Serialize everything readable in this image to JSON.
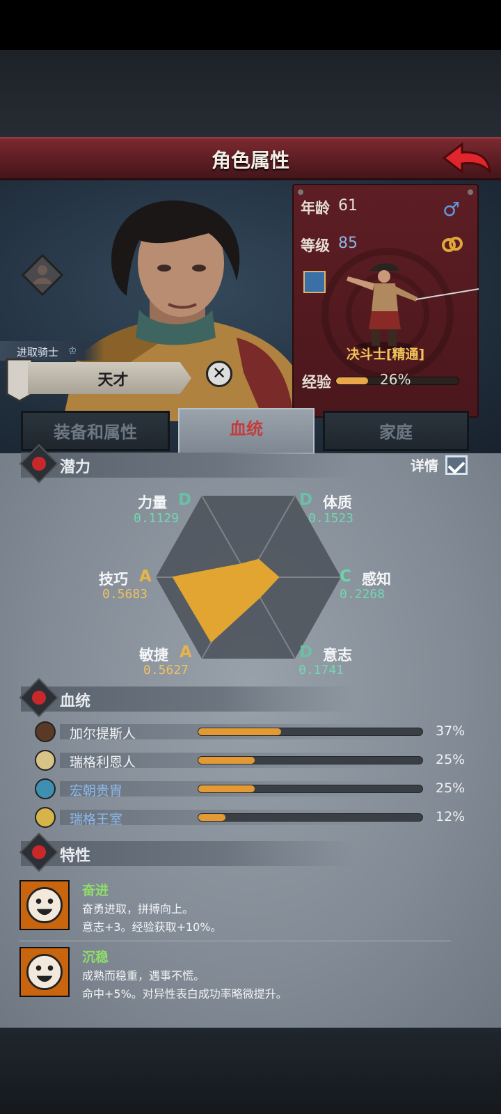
{
  "header": {
    "title": "角色属性"
  },
  "character": {
    "rank_label": "进取骑士",
    "talent": "天才",
    "age_label": "年龄",
    "age": "61",
    "level_label": "等级",
    "level": "85",
    "class_name": "决斗士[精通]",
    "exp_label": "经验",
    "exp_percent": "26%",
    "exp_fraction": 0.26
  },
  "tabs": [
    {
      "label": "装备和属性",
      "active": false
    },
    {
      "label": "血统",
      "active": true
    },
    {
      "label": "家庭",
      "active": false
    }
  ],
  "potential": {
    "title": "潜力",
    "detail_label": "详情",
    "attributes": [
      {
        "name": "力量",
        "grade": "D",
        "value": "0.1129"
      },
      {
        "name": "体质",
        "grade": "D",
        "value": "0.1523"
      },
      {
        "name": "感知",
        "grade": "C",
        "value": "0.2268"
      },
      {
        "name": "意志",
        "grade": "D",
        "value": "0.1741"
      },
      {
        "name": "敏捷",
        "grade": "A",
        "value": "0.5627"
      },
      {
        "name": "技巧",
        "grade": "A",
        "value": "0.5683"
      }
    ]
  },
  "bloodline": {
    "title": "血统",
    "items": [
      {
        "name": "加尔提斯人",
        "percent": "37%",
        "fraction": 0.37,
        "color": "#5a3a26"
      },
      {
        "name": "瑞格利恩人",
        "percent": "25%",
        "fraction": 0.25,
        "color": "#d8c488"
      },
      {
        "name": "宏朝贵胄",
        "percent": "25%",
        "fraction": 0.25,
        "color": "#3f8fb0"
      },
      {
        "name": "瑞格王室",
        "percent": "12%",
        "fraction": 0.12,
        "color": "#d6b44a"
      }
    ]
  },
  "traits": {
    "title": "特性",
    "items": [
      {
        "name": "奋进",
        "description": "奋勇进取，拼搏向上。",
        "effect": "意志+3。经验获取+10%。"
      },
      {
        "name": "沉稳",
        "description": "成熟而稳重，遇事不慌。",
        "effect": "命中+5%。对异性表白成功率略微提升。"
      }
    ]
  },
  "colors": {
    "header": "#5a1c22",
    "accent_gold": "#e39a35",
    "grade_a": "#e6b44a",
    "grade_d": "#69c0a4"
  }
}
